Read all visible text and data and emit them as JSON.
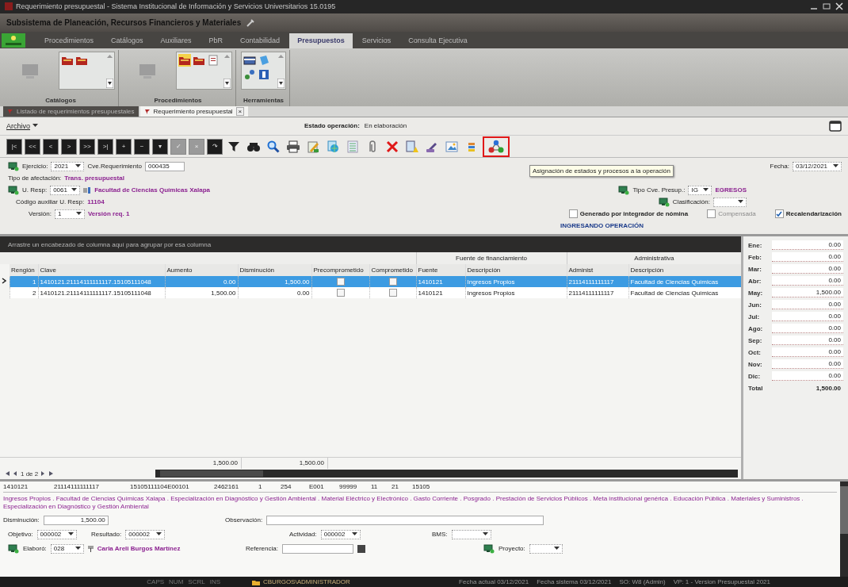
{
  "window": {
    "title": "Requerimiento presupuestal - Sistema Institucional de Información y Servicios Universitarios 15.0195"
  },
  "subsystem": "Subsistema de Planeación, Recursos Financieros y Materiales",
  "ribbon_tabs": [
    {
      "label": "Procedimientos",
      "selected": false
    },
    {
      "label": "Catálogos",
      "selected": false
    },
    {
      "label": "Auxiliares",
      "selected": false
    },
    {
      "label": "PbR",
      "selected": false
    },
    {
      "label": "Contabilidad",
      "selected": false
    },
    {
      "label": "Presupuestos",
      "selected": true
    },
    {
      "label": "Servicios",
      "selected": false
    },
    {
      "label": "Consulta Ejecutiva",
      "selected": false
    }
  ],
  "ribbon_groups": [
    {
      "label": "Catálogos"
    },
    {
      "label": "Procedimientos"
    },
    {
      "label": "Herramientas"
    }
  ],
  "doc_tabs": [
    {
      "label": "Listado de requerimientos presupuestales",
      "selected": false
    },
    {
      "label": "Requerimiento presupuestal",
      "selected": true,
      "close": "×"
    }
  ],
  "menu": {
    "archivo": "Archivo",
    "estado_label": "Estado operación:",
    "estado_value": "En elaboración"
  },
  "nav_buttons": [
    {
      "label": "|<",
      "disabled": false
    },
    {
      "label": "<<",
      "disabled": false
    },
    {
      "label": "<",
      "disabled": false
    },
    {
      "label": ">",
      "disabled": false
    },
    {
      "label": ">>",
      "disabled": false
    },
    {
      "label": ">|",
      "disabled": false
    },
    {
      "label": "+",
      "disabled": false
    },
    {
      "label": "−",
      "disabled": false
    },
    {
      "label": "▾",
      "disabled": false
    },
    {
      "label": "✓",
      "disabled": true
    },
    {
      "label": "×",
      "disabled": true
    },
    {
      "label": "↷",
      "disabled": false
    }
  ],
  "tools": [
    {
      "highlighted": false
    },
    {
      "highlighted": false
    },
    {
      "highlighted": false
    },
    {
      "highlighted": false
    },
    {
      "highlighted": false
    },
    {
      "highlighted": false
    },
    {
      "highlighted": false
    },
    {
      "highlighted": false
    },
    {
      "highlighted": false
    },
    {
      "highlighted": false
    },
    {
      "highlighted": false
    },
    {
      "highlighted": false
    },
    {
      "highlighted": false
    },
    {
      "highlighted": true
    }
  ],
  "tooltip": "Asignación de estados y procesos a la operación",
  "header": {
    "ejercicio": {
      "label": "Ejercicio:",
      "value": "2021"
    },
    "cve_requerimiento": {
      "label": "Cve.Requerimiento",
      "value": "000435"
    },
    "fecha": {
      "label": "Fecha:",
      "value": "03/12/2021"
    },
    "tipo_afectacion": {
      "label": "Tipo de afectación:",
      "value": "Trans. presupuestal"
    },
    "u_resp": {
      "label": "U. Resp:",
      "value": "0061",
      "description": "Facultad de Ciencias Químicas Xalapa"
    },
    "tipo_cve_presup": {
      "label": "Tipo Cve. Presup.:",
      "value": "IG",
      "description": "EGRESOS"
    },
    "codigo_auxiliar": {
      "label": "Código auxiliar U. Resp:",
      "value": "11104"
    },
    "clasificacion": {
      "label": "Clasificación:"
    },
    "version": {
      "label": "Versión:",
      "value": "1",
      "description": "Versión req. 1"
    },
    "checks": [
      {
        "label": "Generado por integrador de nómina",
        "checked": false,
        "disabled": false
      },
      {
        "label": "Compensada",
        "checked": false,
        "disabled": true
      },
      {
        "label": "Recalendarización",
        "checked": true,
        "disabled": false
      }
    ],
    "mode": "INGRESANDO OPERACIÓN"
  },
  "grid": {
    "group_hint": "Arrastre un encabezado de columna aquí para agrupar por esa columna",
    "bands": [
      {
        "label": "Fuente de financiamiento"
      },
      {
        "label": "Administrativa"
      }
    ],
    "columns": [
      "Renglón",
      "Clave",
      "Aumento",
      "Disminución",
      "Precomprometido",
      "Comprometido",
      "Fuente",
      "Descripción",
      "Administ",
      "Descripción"
    ],
    "rows": [
      {
        "selected": true,
        "renglon": "1",
        "clave": "1410121.21114111111117.15105111048",
        "aumento": "0.00",
        "disminucion": "1,500.00",
        "precomprometido": false,
        "comprometido": false,
        "fuente": "1410121",
        "fuente_descripcion": "Ingresos Propios",
        "administ": "21114111111117",
        "admin_descripcion": "Facultad de Ciencias Químicas"
      },
      {
        "selected": false,
        "renglon": "2",
        "clave": "1410121.21114111111117.15105111048",
        "aumento": "1,500.00",
        "disminucion": "0.00",
        "precomprometido": false,
        "comprometido": false,
        "fuente": "1410121",
        "fuente_descripcion": "Ingresos Propios",
        "administ": "21114111111117",
        "admin_descripcion": "Facultad de Ciencias Químicas"
      }
    ],
    "totals": {
      "aumento": "1,500.00",
      "disminucion": "1,500.00"
    },
    "pager": "1 de 2"
  },
  "months": [
    {
      "label": "Ene:",
      "value": "0.00"
    },
    {
      "label": "Feb:",
      "value": "0.00"
    },
    {
      "label": "Mar:",
      "value": "0.00"
    },
    {
      "label": "Abr:",
      "value": "0.00"
    },
    {
      "label": "May:",
      "value": "1,500.00"
    },
    {
      "label": "Jun:",
      "value": "0.00"
    },
    {
      "label": "Jul:",
      "value": "0.00"
    },
    {
      "label": "Ago:",
      "value": "0.00"
    },
    {
      "label": "Sep:",
      "value": "0.00"
    },
    {
      "label": "Oct:",
      "value": "0.00"
    },
    {
      "label": "Nov:",
      "value": "0.00"
    },
    {
      "label": "Dic:",
      "value": "0.00"
    }
  ],
  "month_total": {
    "label": "Total",
    "value": "1,500.00"
  },
  "detail": {
    "key_line": [
      "1410121",
      "21114111111117",
      "15105111104E00101",
      "2462161",
      "1",
      "254",
      "E001",
      "99999",
      "11",
      "21",
      "15105"
    ],
    "description": "Ingresos Propios . Facultad de Ciencias Químicas Xalapa . Especialización en Diagnóstico y Gestión Ambiental . Material Eléctrico y Electrónico . Gasto Corriente . Posgrado . Prestación de Servicios Públicos . Meta institucional genérica . Educación Pública . Materiales y Suministros . Especialización en Diagnóstico y Gestión Ambiental",
    "disminucion": {
      "label": "Disminución:",
      "value": "1,500.00"
    },
    "observacion": {
      "label": "Observación:"
    },
    "objetivo": {
      "label": "Objetivo:",
      "value": "000002"
    },
    "resultado": {
      "label": "Resultado:",
      "value": "000002"
    },
    "actividad": {
      "label": "Actividad:",
      "value": "000002"
    },
    "bms": {
      "label": "BMS:"
    },
    "elaboro": {
      "label": "Elaboró:",
      "value": "028",
      "name": "Carla Areli Burgos Martínez"
    },
    "referencia": {
      "label": "Referencia:"
    },
    "proyecto": {
      "label": "Proyecto:"
    }
  },
  "status_bar": {
    "keys": [
      {
        "label": "CAPS",
        "on": false
      },
      {
        "label": "NUM",
        "on": false
      },
      {
        "label": "SCRL",
        "on": false
      },
      {
        "label": "INS",
        "on": false
      }
    ],
    "user": "CBURGOS\\ADMINISTRADOR",
    "items": [
      "Fecha actual 03/12/2021",
      "Fecha sistema 03/12/2021",
      "SO: W8 (Admin)",
      "VP: 1 - Version Presupuestal 2021"
    ]
  }
}
